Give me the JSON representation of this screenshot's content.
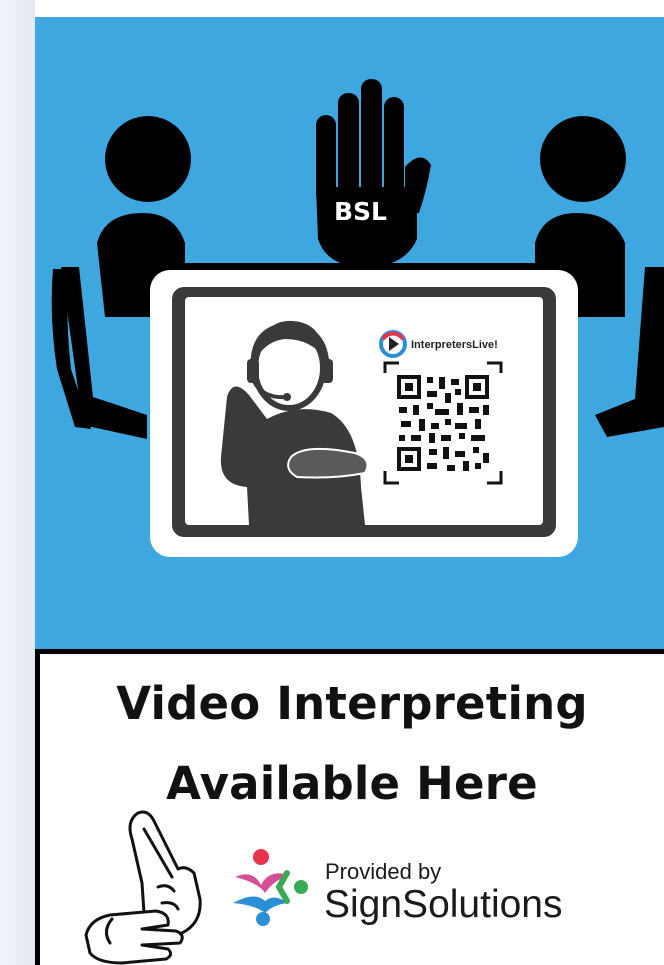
{
  "poster": {
    "hand_badge": "BSL",
    "screen_logo": "InterpretersLive!",
    "headline_line1": "Video Interpreting",
    "headline_line2": "Available Here",
    "provided_by": "Provided by",
    "brand": "SignSolutions"
  },
  "icons": {
    "hand": "raised-hand-icon",
    "people": "person-silhouette-icon",
    "interpreter": "headset-interpreter-icon",
    "qr": "qr-code-icon",
    "sign": "sign-language-hands-icon",
    "brand_mark": "signsolutions-logo-icon"
  },
  "colors": {
    "panel_blue": "#3fa7e0",
    "logo_red": "#e8334a",
    "logo_pink": "#d64f96",
    "logo_blue": "#2b8fd6",
    "logo_green": "#3aaa55"
  }
}
